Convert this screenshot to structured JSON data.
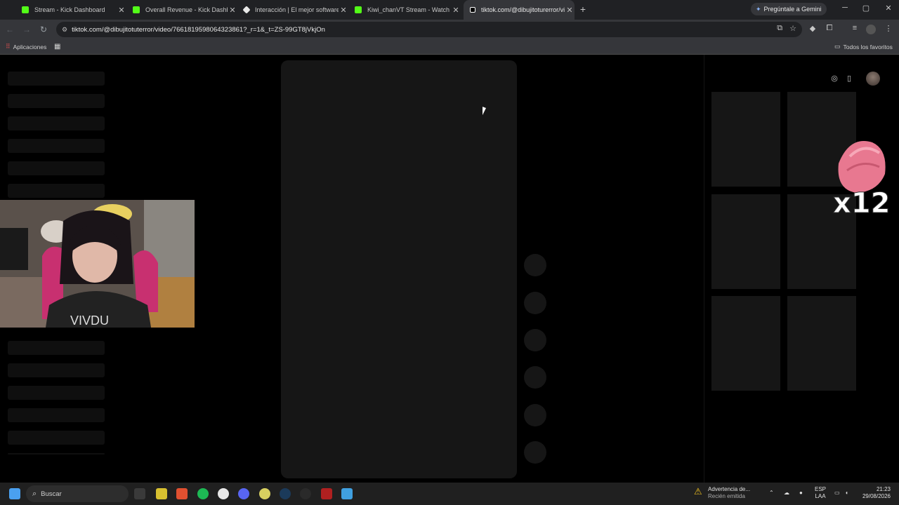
{
  "tabs": [
    {
      "title": "Stream - Kick Dashboard",
      "color": "#53fc18",
      "close": "✕"
    },
    {
      "title": "Overall Revenue - Kick Dashboard",
      "color": "#53fc18",
      "close": "✕"
    },
    {
      "title": "Interacción | El mejor software p",
      "color": "#e8e8e8",
      "close": "✕"
    },
    {
      "title": "Kiwi_chanVT Stream - Watch Live",
      "color": "#53fc18",
      "close": "✕"
    },
    {
      "title": "tiktok.com/@dibujitoturerror/vi",
      "color": "#ffffff",
      "close": "✕"
    }
  ],
  "newtab": "+",
  "gemini": {
    "label": "Pregúntale a Gemini",
    "icon": "gemini-star-icon"
  },
  "window": {
    "minimize": "─",
    "maximize": "▢",
    "close": "✕"
  },
  "nav": {
    "back": "←",
    "forward": "→",
    "reload": "↻"
  },
  "address": {
    "url": "tiktok.com/@dibujitotuterror/video/7661819598064323861?_r=1&_t=ZS-99GT8jVkjOn"
  },
  "bookmarks": {
    "apps": "Aplicaciones",
    "all": "Todos los favoritos"
  },
  "overlay_text": "x12",
  "taskbar": {
    "search_placeholder": "Buscar",
    "warning_title": "Advertencia de...",
    "warning_sub": "Recién emitida",
    "lang_1": "ESP",
    "lang_2": "LAA",
    "time": "21:23",
    "date": "29/08/2026"
  },
  "colors": {
    "chrome_bg": "#202124",
    "toolbar_bg": "#35363a",
    "skeleton": "#161616",
    "accent": "#8ab4f8"
  }
}
